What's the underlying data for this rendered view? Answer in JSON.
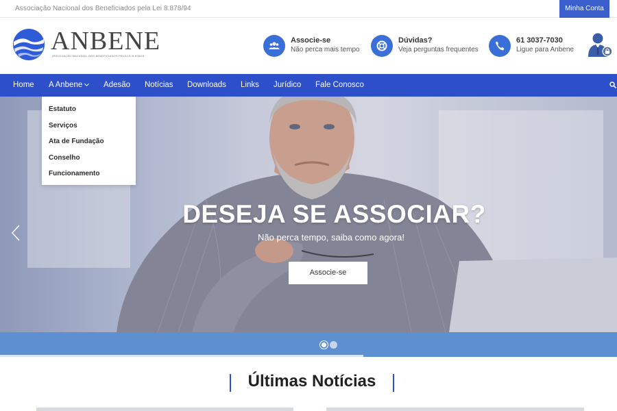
{
  "topbar": {
    "tagline": "Associação Nacional dos Beneficiados pela Lei 8.878/94",
    "account_label": "Minha Conta"
  },
  "brand": {
    "name": "ANBENE",
    "subtitle": "ASSOCIAÇÃO NACIONAL DOS BENEFICIADOS PELA LEI 8.878/94",
    "accent_color": "#2e4fca"
  },
  "header_info": [
    {
      "icon": "group-icon",
      "title": "Associe-se",
      "subtitle": "Não perca mais tempo"
    },
    {
      "icon": "lifebuoy-icon",
      "title": "Dúvidas?",
      "subtitle": "Veja perguntas frequentes"
    },
    {
      "icon": "phone-icon",
      "title": "61 3037-7030",
      "subtitle": "Ligue para Anbene"
    }
  ],
  "nav": {
    "items": [
      "Home",
      "A Anbene",
      "Adesão",
      "Notícias",
      "Downloads",
      "Links",
      "Jurídico",
      "Fale Conosco"
    ],
    "dropdown": [
      "Estatuto",
      "Serviços",
      "Ata de Fundação",
      "Conselho",
      "Funcionamento"
    ]
  },
  "hero": {
    "title": "DESEJA SE ASSOCIAR?",
    "subtitle": "Não perca tempo, saiba como agora!",
    "button_label": "Associe-se",
    "slide_count": 2,
    "active_slide": 1
  },
  "section": {
    "title": "Últimas Notícias"
  }
}
